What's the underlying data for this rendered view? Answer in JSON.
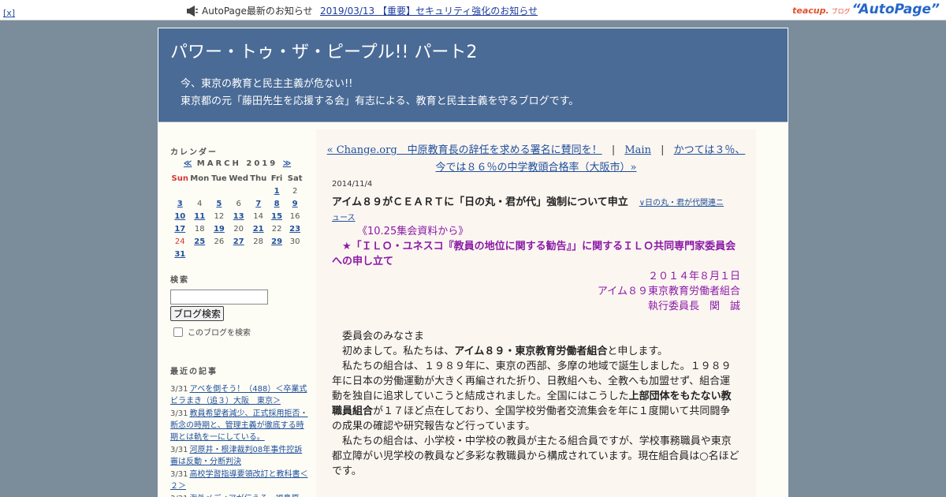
{
  "topbar": {
    "close_label": "[x]",
    "notice_label": "AutoPage最新のお知らせ",
    "notice_link": "2019/03/13 【重要】セキュリティ強化のお知らせ",
    "brand_teacup": "teacup.",
    "brand_blog": "ブログ",
    "brand_autopage": "“AutoPage”"
  },
  "banner": {
    "title": "パワー・トゥ・ザ・ピープル!! パート2",
    "desc_line1": "今、東京の教育と民主主義が危ない!!",
    "desc_line2": "東京都の元「藤田先生を応援する会」有志による、教育と民主主義を守るブログです。"
  },
  "sidebar": {
    "calendar_heading": "カレンダー",
    "calendar_prev": "≪",
    "calendar_month": "MARCH 2019",
    "calendar_next": "≫",
    "weekdays": [
      "Sun",
      "Mon",
      "Tue",
      "Wed",
      "Thu",
      "Fri",
      "Sat"
    ],
    "weeks": [
      [
        {
          "d": ""
        },
        {
          "d": ""
        },
        {
          "d": ""
        },
        {
          "d": ""
        },
        {
          "d": ""
        },
        {
          "d": "1",
          "link": true
        },
        {
          "d": "2"
        }
      ],
      [
        {
          "d": "3",
          "link": true
        },
        {
          "d": "4"
        },
        {
          "d": "5",
          "link": true
        },
        {
          "d": "6"
        },
        {
          "d": "7",
          "link": true
        },
        {
          "d": "8",
          "link": true
        },
        {
          "d": "9",
          "link": true
        }
      ],
      [
        {
          "d": "10",
          "link": true
        },
        {
          "d": "11",
          "link": true
        },
        {
          "d": "12"
        },
        {
          "d": "13",
          "link": true
        },
        {
          "d": "14"
        },
        {
          "d": "15",
          "link": true
        },
        {
          "d": "16"
        }
      ],
      [
        {
          "d": "17",
          "link": true
        },
        {
          "d": "18"
        },
        {
          "d": "19",
          "link": true
        },
        {
          "d": "20"
        },
        {
          "d": "21",
          "link": true
        },
        {
          "d": "22"
        },
        {
          "d": "23",
          "link": true
        }
      ],
      [
        {
          "d": "24",
          "sun": true
        },
        {
          "d": "25",
          "link": true
        },
        {
          "d": "26"
        },
        {
          "d": "27",
          "link": true
        },
        {
          "d": "28"
        },
        {
          "d": "29",
          "link": true
        },
        {
          "d": "30"
        }
      ],
      [
        {
          "d": "31",
          "link": true
        },
        {
          "d": ""
        },
        {
          "d": ""
        },
        {
          "d": ""
        },
        {
          "d": ""
        },
        {
          "d": ""
        },
        {
          "d": ""
        }
      ]
    ],
    "search_heading": "検索",
    "search_value": "",
    "search_button": "ブログ検索",
    "search_option": "このブログを検索",
    "recent_heading": "最近の記事",
    "recent": [
      {
        "date": "3/31",
        "title": "アベを倒そう！（488）＜卒業式ビラまき（追３）大阪　東京＞"
      },
      {
        "date": "3/31",
        "title": "教員希望者減少、正式採用拒否・断念の時期と、管理主義が徹底する時期とは軌を一にしている。"
      },
      {
        "date": "3/31",
        "title": "河原井・根津裁判08年事件控訴審は反動・分断判決"
      },
      {
        "date": "3/31",
        "title": "高校学習指導要領改訂と教科書＜２＞"
      },
      {
        "date": "3/31",
        "title": "海外メディアが伝える、福島原"
      }
    ]
  },
  "content": {
    "prev_link": "« Change.org　中原教育長の辞任を求める署名に賛同を！",
    "sep": "|",
    "main_link": "Main",
    "next_link_1": "かつては３％、",
    "next_link_2": "今では８６％の中学教頭合格率（大阪市）»",
    "date": "2014/11/4",
    "title": "アイム８９がＣＥＡＲＴに「日の丸・君が代」強制について申立",
    "category_1": "∨日の丸・君が代関連ニ",
    "category_2": "ュース",
    "body": {
      "intro": "《10.25集会資料から》",
      "headline": "★「ＩＬＯ・ユネスコ『教員の地位に関する勧告』」に関するＩＬＯ共同専門家委員会への申し立て",
      "sig_date": "２０１４年８月１日",
      "sig_org": "アイム８９東京教育労働者組合",
      "sig_name": "執行委員長　関　誠",
      "p1": "委員会のみなさま",
      "p2_a": "初めまして。私たちは、",
      "p2_b": "アイム８９・東京教育労働者組合",
      "p2_c": "と申します。",
      "p3_a": "私たちの組合は、１９８９年に、東京の西部、多摩の地域で誕生しました。１９８９年に日本の労働運動が大きく再編された折り、日教組へも、全教へも加盟せず、組合運動を独自に追求していこうと結成されました。全国にはこうした",
      "p3_b": "上部団体をもたない教職員組合",
      "p3_c": "が１７ほど点在しており、全国学校労働者交流集会を年に１度開いて共同闘争の成果の確認や研究報告など行っています。",
      "p4": "私たちの組合は、小学校・中学校の教員が主たる組合員ですが、学校事務職員や東京都立障がい児学校の教員など多彩な教職員から構成されています。現在組合員は○名ほどです。"
    }
  }
}
